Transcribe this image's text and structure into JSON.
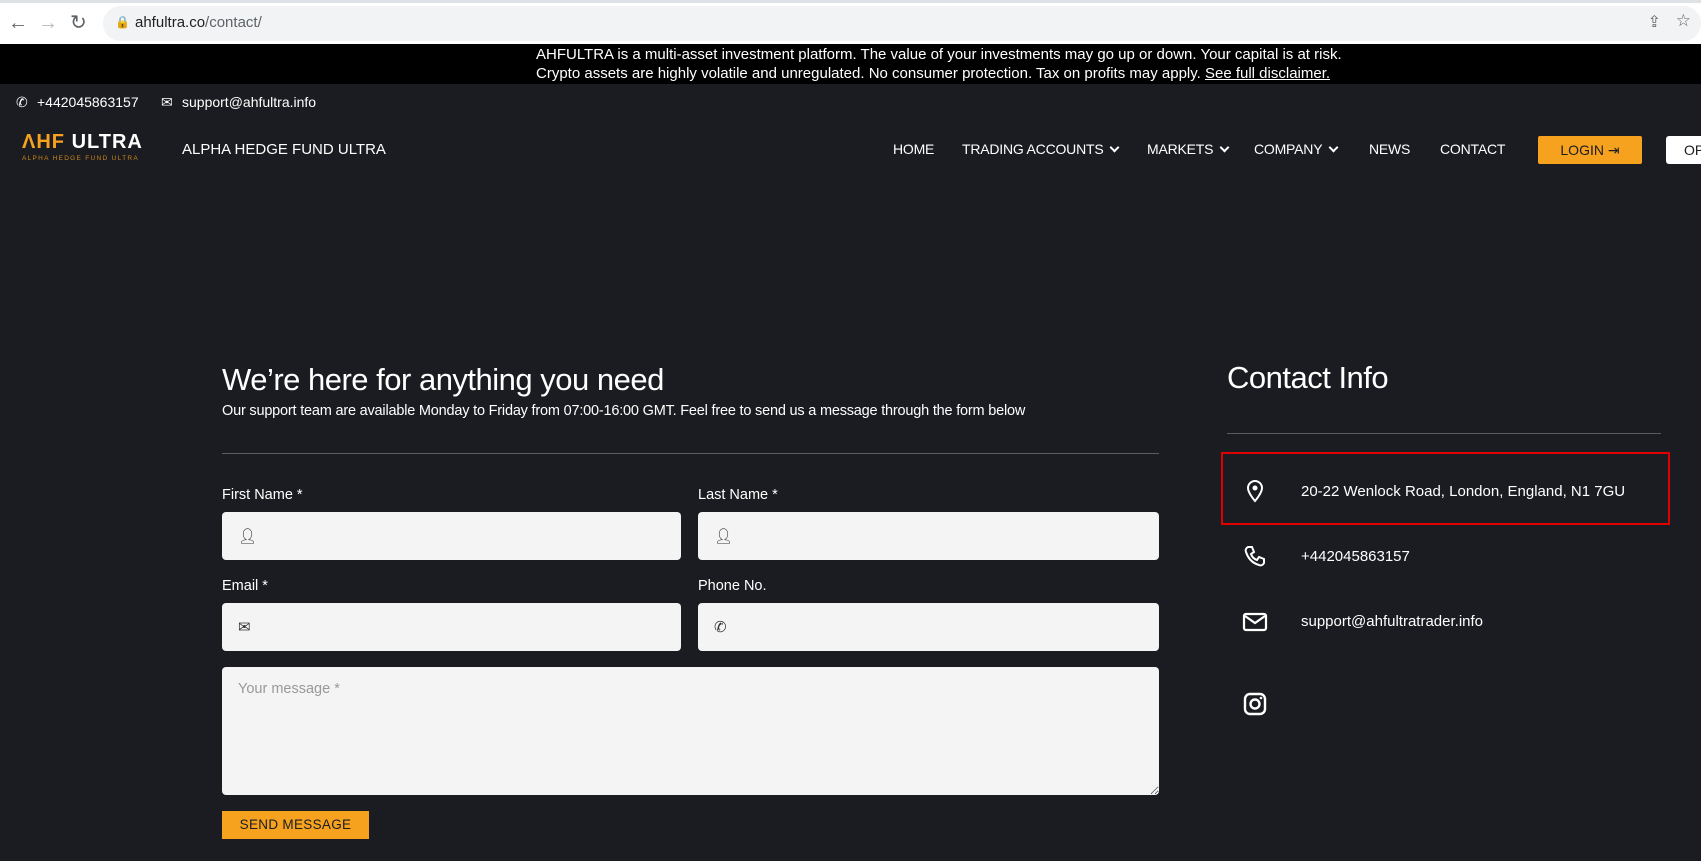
{
  "browser": {
    "url_domain": "ahfultra.co",
    "url_path": "/contact/"
  },
  "banner": {
    "line1": "AHFULTRA is a multi-asset investment platform. The value of your investments may go up or down. Your capital is at risk.",
    "line2": "Crypto assets are highly volatile and unregulated. No consumer protection. Tax on profits may apply.",
    "link": "See full disclaimer."
  },
  "topbar": {
    "phone": "+442045863157",
    "email": "support@ahfultra.info"
  },
  "logo": {
    "main_a": "HF",
    "main_b": "ULTRA",
    "tagline": "ALPHA HEDGE FUND ULTRA"
  },
  "brand_name": "ALPHA HEDGE FUND ULTRA",
  "nav": {
    "home": "HOME",
    "trading": "TRADING ACCOUNTS",
    "markets": "MARKETS",
    "company": "COMPANY",
    "news": "NEWS",
    "contact": "CONTACT",
    "login": "LOGIN",
    "open": "OPEN"
  },
  "form": {
    "title": "We’re here for anything you need",
    "subtitle": "Our support team are available Monday to Friday from 07:00-16:00 GMT. Feel free to send us a message through the form below",
    "first_name": "First Name *",
    "last_name": "Last Name *",
    "email": "Email *",
    "phone": "Phone No.",
    "message_placeholder": "Your message *",
    "send": "SEND MESSAGE"
  },
  "contact": {
    "title": "Contact Info",
    "address": "20-22 Wenlock Road, London, England, N1 7GU",
    "phone": "+442045863157",
    "email": "support@ahfultratrader.info"
  },
  "colors": {
    "accent": "#f7a21f",
    "background": "#1b1c21",
    "highlight": "#e00000"
  }
}
